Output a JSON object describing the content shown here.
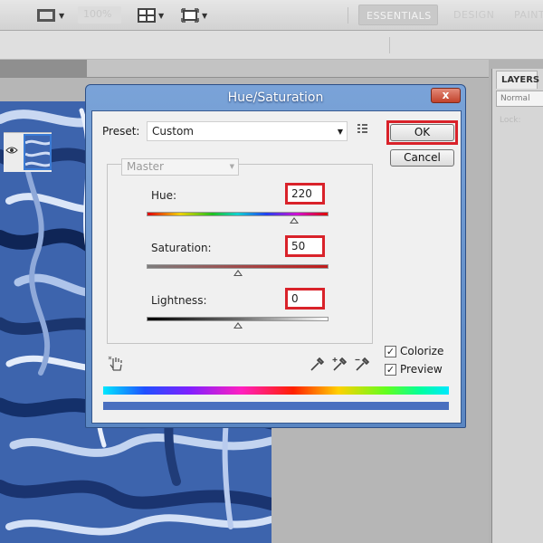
{
  "toolbar": {
    "zoom_value": "100%",
    "workspaces": [
      "ESSENTIALS",
      "DESIGN",
      "PAINTI"
    ]
  },
  "layers": {
    "tab_label": "LAYERS",
    "blend_mode": "Normal",
    "lock_label": "Lock:"
  },
  "dialog": {
    "title": "Hue/Saturation",
    "close_label": "x",
    "preset_label": "Preset:",
    "preset_value": "Custom",
    "edit_channel": "Master",
    "ok_label": "OK",
    "cancel_label": "Cancel",
    "hue": {
      "label": "Hue:",
      "value": "220",
      "slider_fraction": 0.81
    },
    "saturation": {
      "label": "Saturation:",
      "value": "50",
      "slider_fraction": 0.5
    },
    "lightness": {
      "label": "Lightness:",
      "value": "0",
      "slider_fraction": 0.5
    },
    "colorize": {
      "label": "Colorize",
      "checked": true
    },
    "preview": {
      "label": "Preview",
      "checked": true
    },
    "result_color": "#4a6fbf",
    "highlight_color": "#d9222a"
  }
}
